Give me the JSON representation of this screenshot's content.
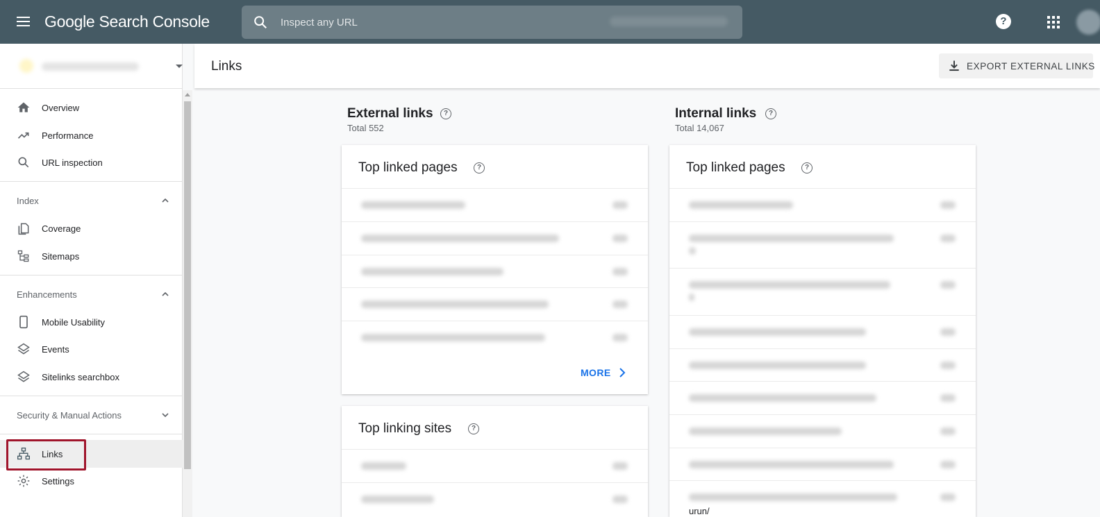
{
  "topbar": {
    "logo_text": "Google Search Console",
    "search_placeholder": "Inspect any URL",
    "help_label": "?"
  },
  "sidebar": {
    "items_top": [
      {
        "label": "Overview",
        "icon": "home-icon"
      },
      {
        "label": "Performance",
        "icon": "trending-up-icon"
      },
      {
        "label": "URL inspection",
        "icon": "search-icon"
      }
    ],
    "sections": {
      "index": {
        "label": "Index",
        "items": [
          {
            "label": "Coverage",
            "icon": "copy-icon"
          },
          {
            "label": "Sitemaps",
            "icon": "sitemap-icon"
          }
        ]
      },
      "enhancements": {
        "label": "Enhancements",
        "items": [
          {
            "label": "Mobile Usability",
            "icon": "phone-icon"
          },
          {
            "label": "Events",
            "icon": "layers-icon"
          },
          {
            "label": "Sitelinks searchbox",
            "icon": "layers-icon"
          }
        ]
      },
      "security": {
        "label": "Security & Manual Actions"
      }
    },
    "links_label": "Links",
    "settings_label": "Settings"
  },
  "header": {
    "title": "Links",
    "export_label": "EXPORT EXTERNAL LINKS"
  },
  "external": {
    "title": "External links",
    "total": "Total 552",
    "top_linked_pages": {
      "title": "Top linked pages",
      "more_label": "MORE"
    },
    "top_linking_sites": {
      "title": "Top linking sites"
    }
  },
  "internal": {
    "title": "Internal links",
    "total": "Total 14,067",
    "top_linked_pages": {
      "title": "Top linked pages",
      "trailing_text": "urun/"
    }
  },
  "colors": {
    "topbar": "#455a64",
    "accent": "#1a73e8",
    "highlight": "#a0142b"
  }
}
